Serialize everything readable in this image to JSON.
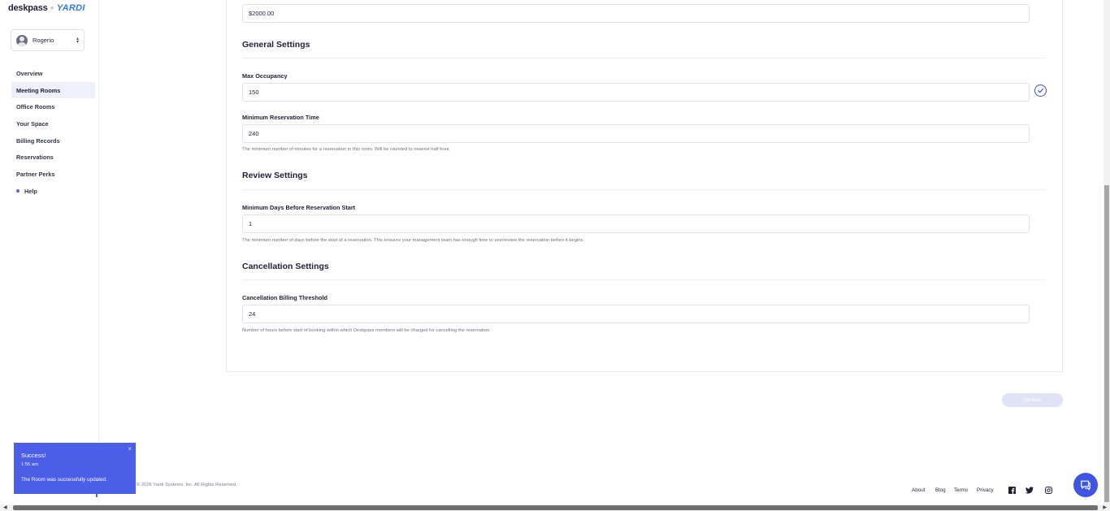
{
  "brand": {
    "name": "deskpass",
    "separator": "+",
    "partner": "YARDI"
  },
  "user": {
    "name": "Rogerio"
  },
  "nav": [
    {
      "label": "Overview"
    },
    {
      "label": "Meeting Rooms",
      "active": true
    },
    {
      "label": "Office Rooms"
    },
    {
      "label": "Your Space"
    },
    {
      "label": "Billing Records"
    },
    {
      "label": "Reservations"
    },
    {
      "label": "Partner Perks"
    },
    {
      "label": "Help",
      "dot": true
    }
  ],
  "form": {
    "price_value": "$2000.00",
    "general": {
      "title": "General Settings",
      "max_occupancy_label": "Max Occupancy",
      "max_occupancy_value": "150",
      "min_res_label": "Minimum Reservation Time",
      "min_res_value": "240",
      "min_res_help": "The minimum number of minutes for a reservation in this room. Will be rounded to nearest half hour."
    },
    "review": {
      "title": "Review Settings",
      "min_days_label": "Minimum Days Before Reservation Start",
      "min_days_value": "1",
      "min_days_help": "The minimum number of days before the start of a reservation. This ensures your management team has enough time to see/review the reservation before it begins."
    },
    "cancellation": {
      "title": "Cancellation Settings",
      "threshold_label": "Cancellation Billing Threshold",
      "threshold_value": "24",
      "threshold_help": "Number of hours before start of booking within which Deskpass members will be charged for cancelling the reservation."
    },
    "update_label": "Update"
  },
  "toast": {
    "title": "Success!",
    "time": "1:55 am",
    "message": "The Room was successfully updated.",
    "close": "×"
  },
  "footer": {
    "copyright": "© 2026 Yardi Systems, Inc. All Rights Reserved.",
    "links": {
      "about": "About",
      "blog": "Blog",
      "terms": "Terms",
      "privacy": "Privacy"
    }
  },
  "colors": {
    "accent": "#4a5ee8",
    "chat": "#3e55e3",
    "yardi": "#2e7ce8"
  },
  "icons": [
    "user-avatar-icon",
    "sort-updown-icon",
    "check-circle-icon",
    "close-icon",
    "facebook-icon",
    "twitter-icon",
    "instagram-icon",
    "chat-icon"
  ]
}
